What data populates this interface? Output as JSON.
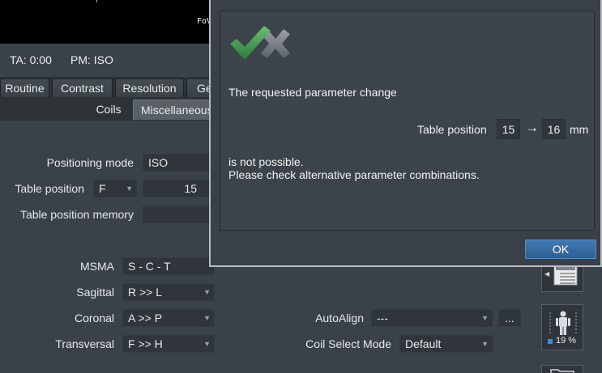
{
  "header": {
    "fov_text": "FoV",
    "ta_label": "TA: 0:00",
    "pm_label": "PM: ISO"
  },
  "tabs": [
    {
      "label": "Routine"
    },
    {
      "label": "Contrast"
    },
    {
      "label": "Resolution"
    },
    {
      "label": "Ge"
    }
  ],
  "subtabs": [
    {
      "label": "Coils"
    },
    {
      "label": "Miscellaneous"
    }
  ],
  "form": {
    "positioning_mode_label": "Positioning mode",
    "positioning_mode_value": "ISO",
    "table_position_label": "Table position",
    "table_position_dir": "F",
    "table_position_value": "15",
    "table_position_memory_label": "Table position memory",
    "table_position_memory_value": "",
    "msma_label": "MSMA",
    "msma_value": "S - C - T",
    "sagittal_label": "Sagittal",
    "sagittal_value": "R >> L",
    "coronal_label": "Coronal",
    "coronal_value": "A >> P",
    "transversal_label": "Transversal",
    "transversal_value": "F >> H",
    "autoalign_label": "AutoAlign",
    "autoalign_value": "---",
    "autoalign_more": "...",
    "coil_select_mode_label": "Coil Select Mode",
    "coil_select_mode_value": "Default"
  },
  "sidebar": {
    "percent": "19 %",
    "level": 0.19
  },
  "dialog": {
    "message_1": "The requested parameter change",
    "param_label": "Table position",
    "old_value": "15",
    "arrow": "→",
    "new_value": "16",
    "unit": "mm",
    "message_2": "is not possible.",
    "message_3": "Please check alternative parameter combinations.",
    "ok_label": "OK"
  },
  "colors": {
    "check_green": "#3f8f4a",
    "x_gray": "#8a9096",
    "ok_blue": "#2e6aa4"
  }
}
